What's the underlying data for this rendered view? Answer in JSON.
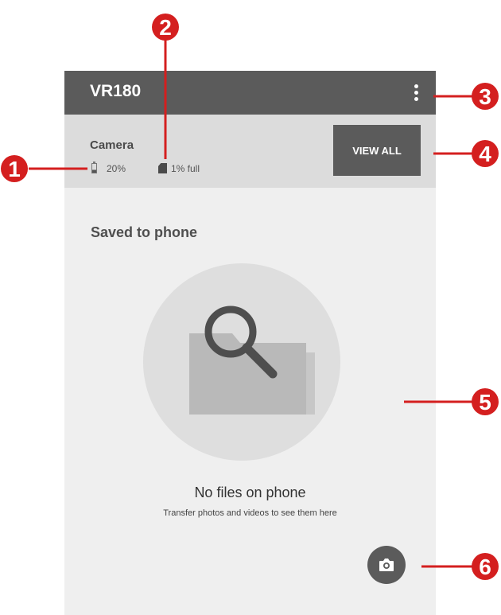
{
  "app": {
    "title": "VR180"
  },
  "camera": {
    "label": "Camera",
    "battery": "20%",
    "storage": "1% full",
    "view_all_label": "VIEW ALL"
  },
  "saved": {
    "title": "Saved to phone",
    "empty_title": "No files on phone",
    "empty_subtitle": "Transfer photos and videos to see them here"
  },
  "icons": {
    "menu": "more-vert-icon",
    "battery": "battery-icon",
    "storage": "sd-card-icon",
    "empty": "folder-search-icon",
    "camera": "camera-icon"
  },
  "callouts": [
    "1",
    "2",
    "3",
    "4",
    "5",
    "6"
  ],
  "colors": {
    "app_bar": "#5b5b5b",
    "panel": "#dcdcdc",
    "background": "#efefef",
    "callout": "#d41f1f"
  }
}
